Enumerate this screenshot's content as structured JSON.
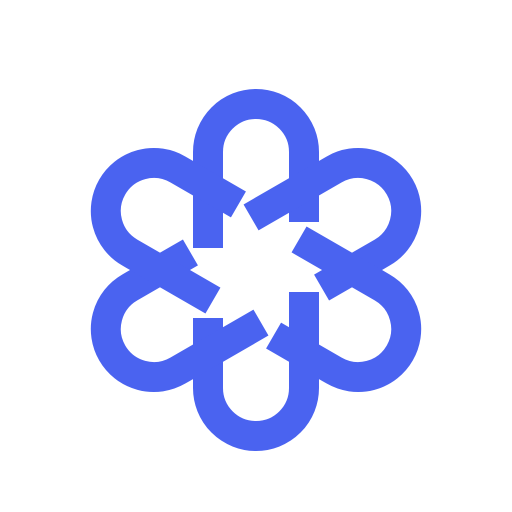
{
  "logo": {
    "icon": "six-fold-knot-logo-icon",
    "color": "#4a63f0",
    "background": "#ffffff",
    "petal_count": 6
  }
}
